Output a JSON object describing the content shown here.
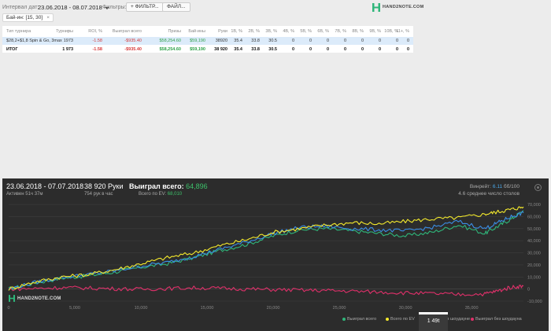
{
  "filters": {
    "date_label": "Интервал дат:",
    "date_range": "23.06.2018 - 08.07.2018",
    "filters_label": "Фильтры:",
    "add_filter": "+ ФИЛЬТР...",
    "file_button": "ФАЙЛ...",
    "chip": "Бай-ин: [15, 30]",
    "chip_close": "×"
  },
  "logo": {
    "text": "HAND2NOTE.COM"
  },
  "table": {
    "headers": [
      "Тип турнира",
      "Турниры",
      "ROI, %",
      "Выиграл всего",
      "Призы",
      "Бай-ины",
      "Руки",
      "1B, %",
      "2B, %",
      "3B, %",
      "4B, %",
      "5B, %",
      "6B, %",
      "7B, %",
      "8B, %",
      "9B, %",
      "10B, %",
      "11+, %"
    ],
    "sort_icon": "↑",
    "rows": [
      [
        "$28,2+$1,8 Spin & Go, 3max",
        "1973",
        "-1.58",
        "-$935.40",
        "$58,254.60",
        "$59,190",
        "38920",
        "35.4",
        "33.8",
        "30.5",
        "0",
        "0",
        "0",
        "0",
        "0",
        "0",
        "0",
        "0"
      ],
      [
        "ИТОГ",
        "1 973",
        "-1.58",
        "-$935.40",
        "$58,254.60",
        "$59,190",
        "38 920",
        "35.4",
        "33.8",
        "30.5",
        "0",
        "0",
        "0",
        "0",
        "0",
        "0",
        "0",
        "0"
      ]
    ]
  },
  "stats": {
    "date_range": "23.06.2018 - 07.07.2018",
    "active": "Активен 51ч 37м",
    "hands": "38 920 Руки",
    "hands_per_hour": "754 рук в час",
    "won_label": "Выиграл всего:",
    "won_value": "64,896",
    "ev_label": "Всего по EV:",
    "ev_value": "68,010",
    "vr_label": "Винрейт:",
    "vr_value": "6.11",
    "vr_unit": "бб/100",
    "tables": "4.6 среднее число столов",
    "tooltip": "1 49t"
  },
  "chart_data": {
    "type": "line",
    "x_ticks": [
      "0",
      "5,000",
      "10,000",
      "15,000",
      "20,000",
      "25,000",
      "30,000",
      "35,000"
    ],
    "y_ticks": [
      "70,000",
      "60,000",
      "50,000",
      "40,000",
      "30,000",
      "20,000",
      "10,000",
      "0",
      "-10,000"
    ],
    "xlim": [
      0,
      38920
    ],
    "ylim": [
      -10000,
      72000
    ],
    "grid": true,
    "legend_position": "bottom-right",
    "series": [
      {
        "name": "Выиграл всего",
        "color": "#2fb67a",
        "x": [
          0,
          2000,
          4000,
          6000,
          8000,
          10000,
          12000,
          14000,
          16000,
          18000,
          20000,
          22000,
          24000,
          26000,
          28000,
          30000,
          32000,
          34000,
          36000,
          37000,
          38000,
          38920
        ],
        "y": [
          0,
          5000,
          9000,
          11000,
          14000,
          18000,
          21000,
          26000,
          32000,
          37000,
          44000,
          49000,
          50000,
          48000,
          46000,
          44000,
          47000,
          53000,
          46000,
          52000,
          58000,
          64896
        ]
      },
      {
        "name": "Всего по EV",
        "color": "#f4ea2c",
        "x": [
          0,
          2000,
          4000,
          6000,
          8000,
          10000,
          12000,
          14000,
          16000,
          18000,
          20000,
          22000,
          24000,
          26000,
          28000,
          30000,
          32000,
          34000,
          36000,
          37000,
          38000,
          38920
        ],
        "y": [
          0,
          6000,
          10000,
          12000,
          16000,
          21000,
          26000,
          30000,
          36000,
          41000,
          47000,
          50000,
          53000,
          55000,
          54000,
          56000,
          58000,
          59000,
          62000,
          64000,
          66000,
          68010
        ]
      },
      {
        "name": "Выиграл в шоудауне",
        "color": "#3b8ee6",
        "x": [
          0,
          2000,
          4000,
          6000,
          8000,
          10000,
          12000,
          14000,
          16000,
          18000,
          20000,
          22000,
          24000,
          26000,
          28000,
          30000,
          32000,
          34000,
          36000,
          37000,
          38000,
          38920
        ],
        "y": [
          0,
          5500,
          9500,
          12000,
          15000,
          19000,
          22000,
          27000,
          33000,
          39000,
          46000,
          51000,
          52000,
          50000,
          49000,
          48000,
          51000,
          56000,
          50000,
          55000,
          60000,
          63000
        ]
      },
      {
        "name": "Выиграл без шоудауна",
        "color": "#e0306a",
        "x": [
          0,
          2000,
          4000,
          6000,
          8000,
          10000,
          12000,
          14000,
          16000,
          18000,
          20000,
          22000,
          24000,
          26000,
          28000,
          30000,
          32000,
          34000,
          36000,
          37000,
          38000,
          38920
        ],
        "y": [
          0,
          500,
          1200,
          800,
          300,
          -200,
          400,
          1000,
          600,
          0,
          -500,
          -900,
          -1200,
          -1800,
          -2500,
          -3200,
          -3800,
          -4500,
          -4000,
          -1500,
          1500,
          2500
        ]
      }
    ]
  }
}
